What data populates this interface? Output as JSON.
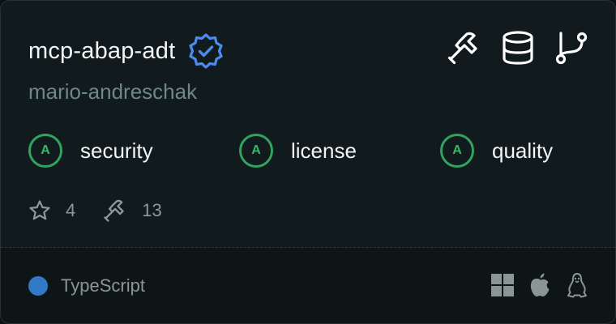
{
  "server": {
    "name": "mcp-abap-adt",
    "author": "mario-andreschak",
    "verified": true,
    "features": [
      "tools-icon",
      "database-icon",
      "git-branch-icon"
    ]
  },
  "scores": [
    {
      "grade": "A",
      "label": "security"
    },
    {
      "grade": "A",
      "label": "license"
    },
    {
      "grade": "A",
      "label": "quality"
    }
  ],
  "stats": {
    "stars": "4",
    "tools": "13"
  },
  "footer": {
    "language": "TypeScript",
    "language_color": "#3178c6",
    "platforms": [
      "windows-icon",
      "apple-icon",
      "linux-icon"
    ]
  },
  "colors": {
    "accent_verified": "#4a8cf0",
    "grade_green": "#2fa35f"
  }
}
